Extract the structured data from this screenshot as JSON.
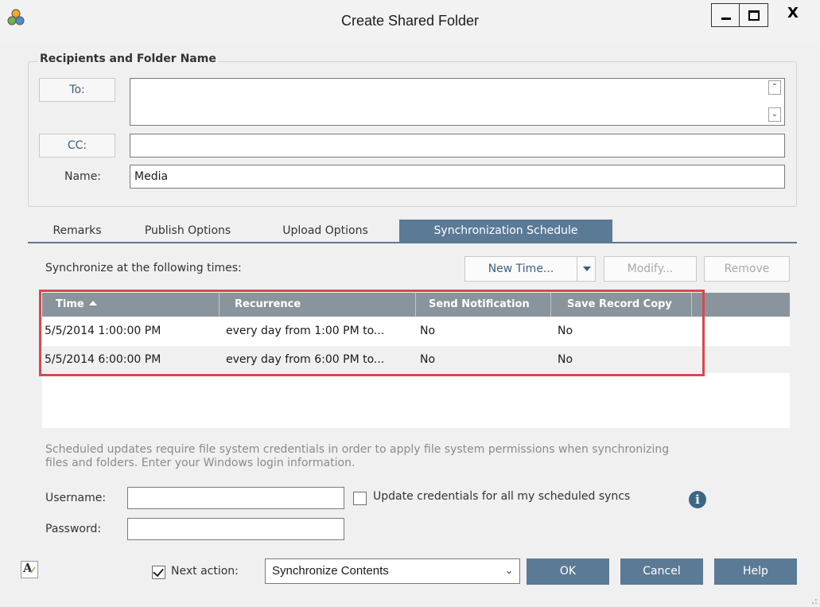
{
  "window": {
    "title": "Create Shared Folder",
    "app_icon": "three-circles-icon",
    "controls": {
      "minimize": "minimize-icon",
      "maximize": "maximize-icon",
      "close_label": "X"
    }
  },
  "recipients": {
    "group_title": "Recipients and Folder Name",
    "to_button": "To:",
    "to_value": "",
    "cc_button": "CC:",
    "cc_value": "",
    "name_label": "Name:",
    "name_value": "Media"
  },
  "tabs": [
    {
      "label": "Remarks",
      "active": false
    },
    {
      "label": "Publish Options",
      "active": false
    },
    {
      "label": "Upload Options",
      "active": false
    },
    {
      "label": "Synchronization Schedule",
      "active": true
    }
  ],
  "schedule": {
    "heading": "Synchronize at the following times:",
    "new_time_label": "New Time...",
    "modify_label": "Modify...",
    "remove_label": "Remove",
    "columns": [
      "Time",
      "Recurrence",
      "Send Notification",
      "Save Record Copy"
    ],
    "sort_column": "Time",
    "rows": [
      {
        "time": "5/5/2014 1:00:00 PM",
        "recurrence": "every day from 1:00 PM to...",
        "send_notification": "No",
        "save_record_copy": "No"
      },
      {
        "time": "5/5/2014 6:00:00 PM",
        "recurrence": "every day from 6:00 PM to...",
        "send_notification": "No",
        "save_record_copy": "No"
      }
    ]
  },
  "credentials": {
    "note_line1": "Scheduled updates require file system credentials in order to apply file system permissions when synchronizing",
    "note_line2": "files and folders. Enter your Windows login information.",
    "username_label": "Username:",
    "username_value": "",
    "password_label": "Password:",
    "password_value": "",
    "update_all_label": "Update credentials for all my scheduled syncs",
    "update_all_checked": false,
    "info_glyph": "i"
  },
  "footer": {
    "next_action_label": "Next action:",
    "next_action_checked": true,
    "next_action_value": "Synchronize Contents",
    "ok_label": "OK",
    "cancel_label": "Cancel",
    "help_label": "Help"
  },
  "colors": {
    "accent": "#5b7a96",
    "grid_header": "#8a949c",
    "highlight_border": "#d9474f"
  }
}
